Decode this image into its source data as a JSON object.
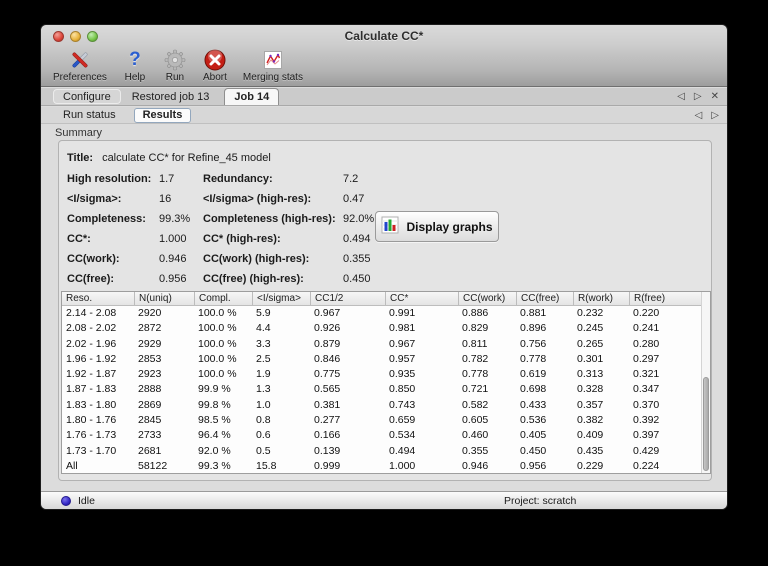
{
  "window_title": "Calculate CC*",
  "toolbar": {
    "preferences": "Preferences",
    "help": "Help",
    "run": "Run",
    "abort": "Abort",
    "merging_stats": "Merging stats",
    "help_glyph": "?"
  },
  "tabs": {
    "configure": "Configure",
    "restored_job": "Restored job 13",
    "job": "Job 14"
  },
  "tab_nav": {
    "back": "◁",
    "forward": "▷",
    "close": "✕"
  },
  "subtabs": {
    "run_status": "Run status",
    "results": "Results"
  },
  "summary": {
    "section_label": "Summary",
    "title_label": "Title:",
    "title_value": "calculate CC* for Refine_45 model",
    "stats": [
      {
        "l1": "High resolution:",
        "v1": "1.7",
        "l2": "Redundancy:",
        "v2": "7.2"
      },
      {
        "l1": "<I/sigma>:",
        "v1": "16",
        "l2": "<I/sigma> (high-res):",
        "v2": "0.47"
      },
      {
        "l1": "Completeness:",
        "v1": "99.3%",
        "l2": "Completeness (high-res):",
        "v2": "92.0%"
      },
      {
        "l1": "CC*:",
        "v1": "1.000",
        "l2": "CC* (high-res):",
        "v2": "0.494"
      },
      {
        "l1": "CC(work):",
        "v1": "0.946",
        "l2": "CC(work) (high-res):",
        "v2": "0.355"
      },
      {
        "l1": "CC(free):",
        "v1": "0.956",
        "l2": "CC(free) (high-res):",
        "v2": "0.450"
      }
    ],
    "display_graphs": "Display graphs"
  },
  "table": {
    "columns": [
      "Reso.",
      "N(uniq)",
      "Compl.",
      "<I/sigma>",
      "CC1/2",
      "CC*",
      "CC(work)",
      "CC(free)",
      "R(work)",
      "R(free)"
    ],
    "rows": [
      [
        "2.14 - 2.08",
        "2920",
        "100.0 %",
        "5.9",
        "0.967",
        "0.991",
        "0.886",
        "0.881",
        "0.232",
        "0.220"
      ],
      [
        "2.08 - 2.02",
        "2872",
        "100.0 %",
        "4.4",
        "0.926",
        "0.981",
        "0.829",
        "0.896",
        "0.245",
        "0.241"
      ],
      [
        "2.02 - 1.96",
        "2929",
        "100.0 %",
        "3.3",
        "0.879",
        "0.967",
        "0.811",
        "0.756",
        "0.265",
        "0.280"
      ],
      [
        "1.96 - 1.92",
        "2853",
        "100.0 %",
        "2.5",
        "0.846",
        "0.957",
        "0.782",
        "0.778",
        "0.301",
        "0.297"
      ],
      [
        "1.92 - 1.87",
        "2923",
        "100.0 %",
        "1.9",
        "0.775",
        "0.935",
        "0.778",
        "0.619",
        "0.313",
        "0.321"
      ],
      [
        "1.87 - 1.83",
        "2888",
        "99.9 %",
        "1.3",
        "0.565",
        "0.850",
        "0.721",
        "0.698",
        "0.328",
        "0.347"
      ],
      [
        "1.83 - 1.80",
        "2869",
        "99.8 %",
        "1.0",
        "0.381",
        "0.743",
        "0.582",
        "0.433",
        "0.357",
        "0.370"
      ],
      [
        "1.80 - 1.76",
        "2845",
        "98.5 %",
        "0.8",
        "0.277",
        "0.659",
        "0.605",
        "0.536",
        "0.382",
        "0.392"
      ],
      [
        "1.76 - 1.73",
        "2733",
        "96.4 %",
        "0.6",
        "0.166",
        "0.534",
        "0.460",
        "0.405",
        "0.409",
        "0.397"
      ],
      [
        "1.73 - 1.70",
        "2681",
        "92.0 %",
        "0.5",
        "0.139",
        "0.494",
        "0.355",
        "0.450",
        "0.435",
        "0.429"
      ],
      [
        "All",
        "58122",
        "99.3 %",
        "15.8",
        "0.999",
        "1.000",
        "0.946",
        "0.956",
        "0.229",
        "0.224"
      ]
    ]
  },
  "statusbar": {
    "state": "Idle",
    "project": "Project: scratch"
  },
  "colors": {
    "abort_red": "#c41e14",
    "help_blue": "#2c5fd0",
    "status_dot_blue": "#3428c6",
    "chart_bar_blue": "#2244cc",
    "chart_bar_green": "#22aa33",
    "chart_bar_red": "#cc2222"
  }
}
